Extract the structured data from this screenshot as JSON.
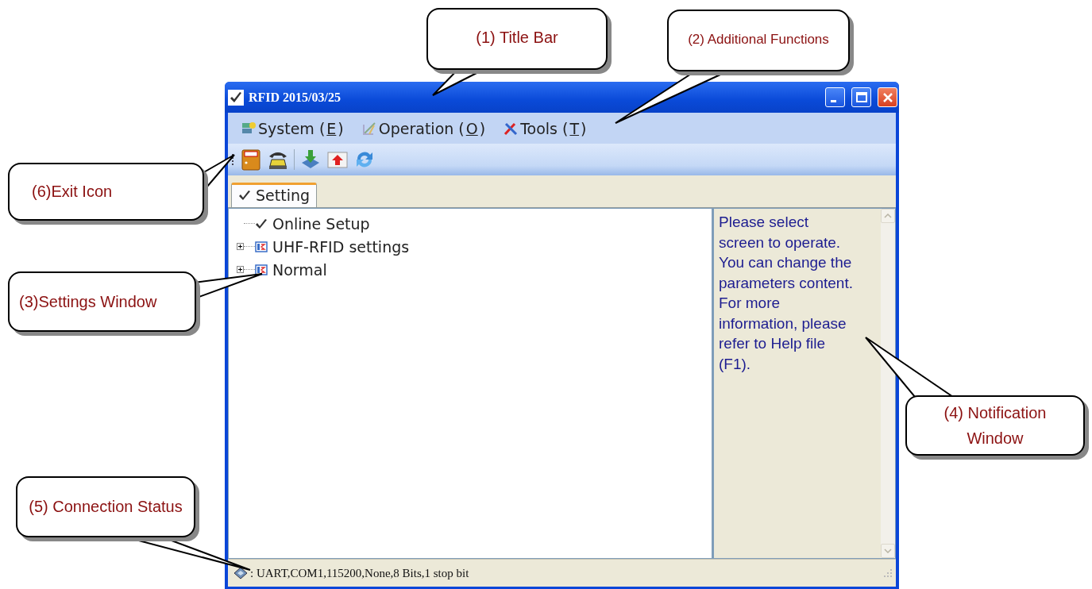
{
  "window": {
    "title": "RFID 2015/03/25"
  },
  "menu": [
    {
      "before": "System (",
      "key": "E",
      "after": ")",
      "kind": "system"
    },
    {
      "before": "Operation (",
      "key": "O",
      "after": ")",
      "kind": "operation"
    },
    {
      "before": "Tools (",
      "key": "T",
      "after": ")",
      "kind": "tools"
    }
  ],
  "tabs": [
    {
      "label": "Setting",
      "selected": true
    }
  ],
  "tree": [
    {
      "label": "Online Setup",
      "kind": "check"
    },
    {
      "label": "UHF-RFID settings",
      "kind": "folder",
      "expanded": false
    },
    {
      "label": "Normal",
      "kind": "folder",
      "expanded": false
    }
  ],
  "notification": [
    "Please select screen to operate. You can change the parameters content.",
    "For more information, please refer to Help file (F1)."
  ],
  "status_bar": ": UART,COM1,115200,None,8 Bits,1 stop bit",
  "callouts": [
    "(1) Title Bar",
    "(2) Additional Functions",
    "(6)Exit Icon",
    "(3)Settings Window",
    "(4)  Notification Window",
    "(5) Connection Status"
  ]
}
